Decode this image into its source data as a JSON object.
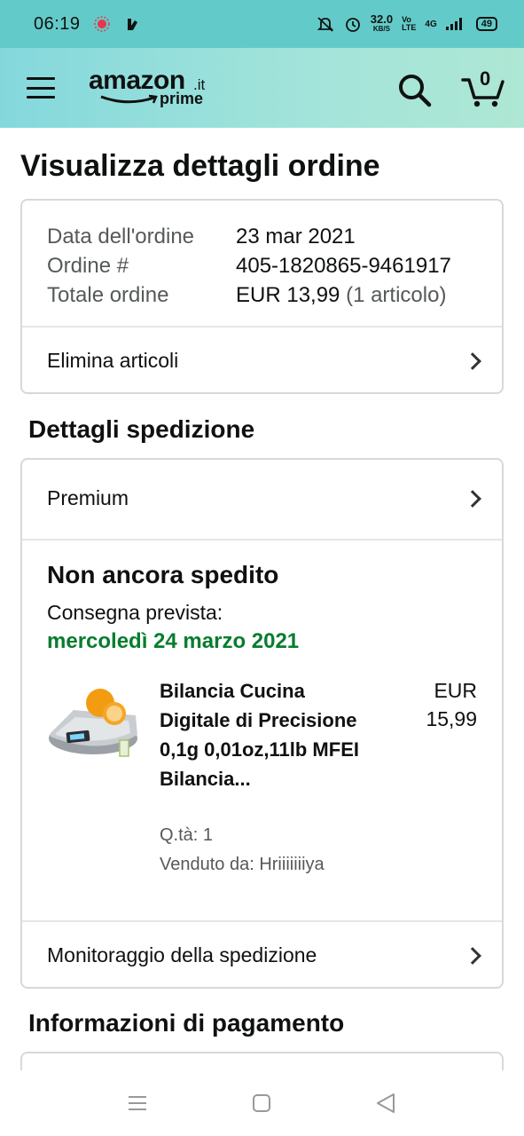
{
  "status_bar": {
    "time": "06:19",
    "speed_value": "32.0",
    "speed_unit": "KB/S",
    "volte_top": "Vo",
    "volte_bottom": "LTE",
    "network": "4G",
    "battery": "49"
  },
  "header": {
    "logo_text": "amazon",
    "logo_tld": ".it",
    "logo_prime": "prime",
    "cart_count": "0"
  },
  "page": {
    "title": "Visualizza dettagli ordine"
  },
  "order": {
    "date_label": "Data dell'ordine",
    "date_value": "23 mar 2021",
    "number_label": "Ordine #",
    "number_value": "405-1820865-9461917",
    "total_label": "Totale ordine",
    "total_value": "EUR 13,99",
    "total_items": "(1 articolo)",
    "delete_items_label": "Elimina articoli"
  },
  "shipping": {
    "section_title": "Dettagli spedizione",
    "method": "Premium",
    "status": "Non ancora spedito",
    "expected_label": "Consegna prevista:",
    "expected_date": "mercoledì 24 marzo 2021",
    "tracking_label": "Monitoraggio della spedizione",
    "product": {
      "title": "Bilancia Cucina Digitale di Precisione 0,1g 0,01oz,11lb MFEI Bilancia...",
      "price_currency": "EUR",
      "price_value": "15,99",
      "quantity": "Q.tà: 1",
      "seller": "Venduto da: Hriiiiiiiya"
    }
  },
  "payment": {
    "section_title": "Informazioni di pagamento"
  },
  "colors": {
    "status_bar_bg": "#62cbc9",
    "header_gradient_start": "#84d8dc",
    "header_gradient_end": "#aee7d4",
    "delivery_green": "#067d2e",
    "border": "#d5d9d9"
  },
  "icons": [
    "menu-icon",
    "search-icon",
    "cart-icon",
    "chevron-right-icon",
    "nav-recents-icon",
    "nav-home-icon",
    "nav-back-icon"
  ]
}
